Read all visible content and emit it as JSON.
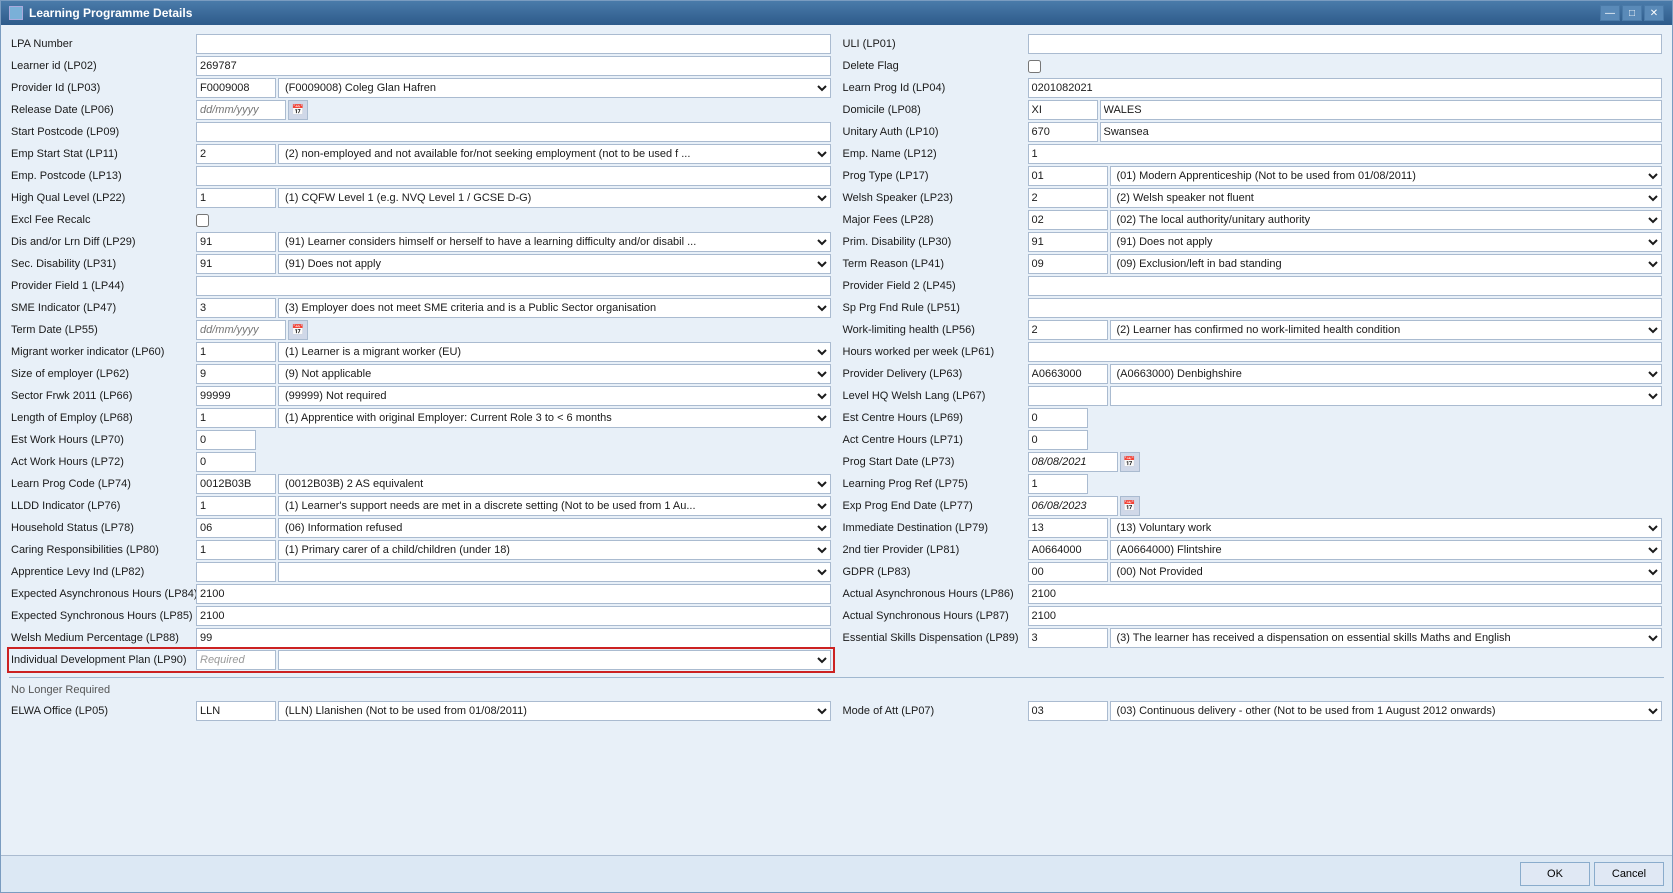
{
  "window": {
    "title": "Learning Programme Details",
    "controls": {
      "minimize": "—",
      "maximize": "□",
      "close": "✕"
    }
  },
  "left": [
    {
      "label": "LPA Number",
      "id": "lpa-number",
      "type": "text-full",
      "value": ""
    },
    {
      "label": "Learner id (LP02)",
      "id": "learner-id",
      "type": "text-static",
      "value": "269787"
    },
    {
      "label": "Provider Id (LP03)",
      "id": "provider-id",
      "type": "short-dropdown",
      "short": "F0009008",
      "dropdown": "(F0009008) Coleg Glan Hafren"
    },
    {
      "label": "Release Date (LP06)",
      "id": "release-date",
      "type": "date",
      "value": "dd/mm/yyyy"
    },
    {
      "label": "Start Postcode (LP09)",
      "id": "start-postcode",
      "type": "text-full",
      "value": ""
    },
    {
      "label": "Emp Start Stat (LP11)",
      "id": "emp-start-stat",
      "type": "short-dropdown",
      "short": "2",
      "dropdown": "(2) non-employed and not available for/not seeking employment (not to be used f ..."
    },
    {
      "label": "Emp. Postcode (LP13)",
      "id": "emp-postcode",
      "type": "text-full",
      "value": ""
    },
    {
      "label": "High Qual Level (LP22)",
      "id": "high-qual",
      "type": "short-dropdown",
      "short": "1",
      "dropdown": "(1) CQFW Level 1 (e.g. NVQ Level 1 / GCSE D-G)"
    },
    {
      "label": "Excl Fee Recalc",
      "id": "excl-fee",
      "type": "checkbox",
      "checked": false
    },
    {
      "label": "Dis and/or Lrn Diff (LP29)",
      "id": "dis-lrn",
      "type": "short-dropdown",
      "short": "91",
      "dropdown": "(91) Learner considers himself or herself to have a learning difficulty and/or disabil ..."
    },
    {
      "label": "Sec. Disability (LP31)",
      "id": "sec-dis",
      "type": "short-dropdown",
      "short": "91",
      "dropdown": "(91) Does not apply"
    },
    {
      "label": "Provider Field 1 (LP44)",
      "id": "prov-field1",
      "type": "text-full",
      "value": ""
    },
    {
      "label": "SME Indicator (LP47)",
      "id": "sme",
      "type": "short-dropdown",
      "short": "3",
      "dropdown": "(3) Employer does not meet SME criteria and is a Public Sector organisation"
    },
    {
      "label": "Term Date (LP55)",
      "id": "term-date",
      "type": "date",
      "value": "dd/mm/yyyy"
    },
    {
      "label": "Migrant worker indicator (LP60)",
      "id": "migrant",
      "type": "short-dropdown",
      "short": "1",
      "dropdown": "(1) Learner is a migrant worker (EU)"
    },
    {
      "label": "Size of employer (LP62)",
      "id": "size-emp",
      "type": "short-dropdown",
      "short": "9",
      "dropdown": "(9) Not applicable"
    },
    {
      "label": "Sector Frwk 2011 (LP66)",
      "id": "sector",
      "type": "short-dropdown",
      "short": "99999",
      "dropdown": "(99999) Not required"
    },
    {
      "label": "Length of Employ (LP68)",
      "id": "length-emp",
      "type": "short-dropdown",
      "short": "1",
      "dropdown": "(1) Apprentice with original Employer: Current Role 3 to < 6 months"
    },
    {
      "label": "Est Work Hours (LP70)",
      "id": "est-work",
      "type": "text-num",
      "value": "0"
    },
    {
      "label": "Act Work Hours (LP72)",
      "id": "act-work",
      "type": "text-num",
      "value": "0"
    },
    {
      "label": "Learn Prog Code (LP74)",
      "id": "learn-prog",
      "type": "short-dropdown",
      "short": "0012B03B",
      "dropdown": "(0012B03B) 2 AS equivalent"
    },
    {
      "label": "LLDD Indicator (LP76)",
      "id": "lldd",
      "type": "short-dropdown",
      "short": "1",
      "dropdown": "(1) Learner's support needs are met in a discrete setting (Not to be used from 1 Au..."
    },
    {
      "label": "Household Status (LP78)",
      "id": "household",
      "type": "short-dropdown",
      "short": "06",
      "dropdown": "(06) Information refused"
    },
    {
      "label": "Caring Responsibilities (LP80)",
      "id": "caring",
      "type": "short-dropdown",
      "short": "1",
      "dropdown": "(1) Primary carer of a child/children (under 18)"
    },
    {
      "label": "Apprentice Levy Ind (LP82)",
      "id": "app-levy",
      "type": "short-dropdown",
      "short": "",
      "dropdown": ""
    },
    {
      "label": "Expected Asynchronous Hours (LP84)",
      "id": "exp-async",
      "type": "text-num",
      "value": "2100"
    },
    {
      "label": "Expected Synchronous Hours (LP85)",
      "id": "exp-sync",
      "type": "text-num",
      "value": "2100"
    },
    {
      "label": "Welsh Medium Percentage (LP88)",
      "id": "welsh-pct",
      "type": "text-num",
      "value": "99"
    },
    {
      "label": "Individual Development Plan (LP90)",
      "id": "idp",
      "type": "short-dropdown-highlighted",
      "short": "Required",
      "dropdown": ""
    }
  ],
  "right": [
    {
      "label": "ULI (LP01)",
      "id": "uli",
      "type": "text-full",
      "value": ""
    },
    {
      "label": "Delete Flag",
      "id": "delete-flag",
      "type": "checkbox",
      "checked": false
    },
    {
      "label": "Learn Prog Id (LP04)",
      "id": "learn-prog-id",
      "type": "text-static",
      "value": "0201082021"
    },
    {
      "label": "Domicile (LP08)",
      "id": "domicile",
      "type": "two-text",
      "val1": "XI",
      "val2": "WALES"
    },
    {
      "label": "Unitary Auth (LP10)",
      "id": "unitary",
      "type": "two-text",
      "val1": "670",
      "val2": "Swansea"
    },
    {
      "label": "Emp. Name (LP12)",
      "id": "emp-name",
      "type": "text-full",
      "value": "1"
    },
    {
      "label": "Prog Type (LP17)",
      "id": "prog-type",
      "type": "short-dropdown",
      "short": "01",
      "dropdown": "(01) Modern Apprenticeship (Not to be used from 01/08/2011)"
    },
    {
      "label": "Welsh Speaker (LP23)",
      "id": "welsh-speaker",
      "type": "short-dropdown",
      "short": "2",
      "dropdown": "(2) Welsh speaker not fluent"
    },
    {
      "label": "Major Fees (LP28)",
      "id": "major-fees",
      "type": "short-dropdown",
      "short": "02",
      "dropdown": "(02) The local authority/unitary authority"
    },
    {
      "label": "Prim. Disability (LP30)",
      "id": "prim-dis",
      "type": "short-dropdown",
      "short": "91",
      "dropdown": "(91) Does not apply"
    },
    {
      "label": "Term Reason (LP41)",
      "id": "term-reason",
      "type": "short-dropdown",
      "short": "09",
      "dropdown": "(09) Exclusion/left in bad standing"
    },
    {
      "label": "Provider Field 2 (LP45)",
      "id": "prov-field2",
      "type": "text-full",
      "value": ""
    },
    {
      "label": "Sp Prg Fnd Rule (LP51)",
      "id": "sp-prg",
      "type": "text-full",
      "value": ""
    },
    {
      "label": "Work-limiting health (LP56)",
      "id": "work-health",
      "type": "short-dropdown",
      "short": "2",
      "dropdown": "(2) Learner has confirmed no work-limited health condition"
    },
    {
      "label": "Hours worked per week (LP61)",
      "id": "hours-week",
      "type": "text-full",
      "value": ""
    },
    {
      "label": "Provider Delivery (LP63)",
      "id": "prov-delivery",
      "type": "short-dropdown",
      "short": "A0663000",
      "dropdown": "(A0663000) Denbighshire"
    },
    {
      "label": "Level HQ Welsh Lang (LP67)",
      "id": "level-hq",
      "type": "short-dropdown",
      "short": "",
      "dropdown": ""
    },
    {
      "label": "Est Centre Hours (LP69)",
      "id": "est-centre",
      "type": "text-num",
      "value": "0"
    },
    {
      "label": "Act Centre Hours (LP71)",
      "id": "act-centre",
      "type": "text-num",
      "value": "0"
    },
    {
      "label": "Prog Start Date (LP73)",
      "id": "prog-start",
      "type": "date",
      "value": "08/08/2021"
    },
    {
      "label": "Learning Prog Ref (LP75)",
      "id": "learn-ref",
      "type": "text-num",
      "value": "1"
    },
    {
      "label": "Exp Prog End Date (LP77)",
      "id": "exp-end",
      "type": "date",
      "value": "06/08/2023"
    },
    {
      "label": "Immediate Destination (LP79)",
      "id": "imm-dest",
      "type": "short-dropdown",
      "short": "13",
      "dropdown": "(13) Voluntary work"
    },
    {
      "label": "2nd tier Provider (LP81)",
      "id": "tier2",
      "type": "short-dropdown",
      "short": "A0664000",
      "dropdown": "(A0664000) Flintshire"
    },
    {
      "label": "GDPR (LP83)",
      "id": "gdpr",
      "type": "short-dropdown",
      "short": "00",
      "dropdown": "(00) Not Provided"
    },
    {
      "label": "Actual Asynchronous Hours (LP86)",
      "id": "act-async",
      "type": "text-num",
      "value": "2100"
    },
    {
      "label": "Actual Synchronous Hours (LP87)",
      "id": "act-sync",
      "type": "text-num",
      "value": "2100"
    },
    {
      "label": "Essential Skills Dispensation (LP89)",
      "id": "ess-skills",
      "type": "short-dropdown",
      "short": "3",
      "dropdown": "(3) The learner has received a dispensation on essential skills Maths and English"
    }
  ],
  "bottom_left": [
    {
      "label": "ELWA Office (LP05)",
      "id": "elwa",
      "type": "short-dropdown",
      "short": "LLN",
      "dropdown": "(LLN) Llanishen (Not to be used from 01/08/2011)"
    }
  ],
  "bottom_right": [
    {
      "label": "Mode of Att (LP07)",
      "id": "mode-att",
      "type": "short-dropdown",
      "short": "03",
      "dropdown": "(03) Continuous delivery - other (Not to be used from 1 August 2012 onwards)"
    }
  ],
  "footer": {
    "ok": "OK",
    "cancel": "Cancel"
  },
  "no_longer_required": "No Longer Required"
}
